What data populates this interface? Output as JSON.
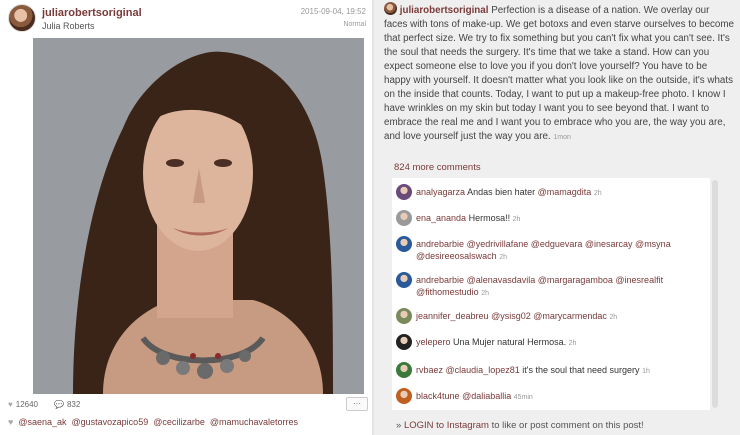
{
  "post": {
    "username": "juliarobertsoriginal",
    "real_name": "Julia Roberts",
    "timestamp": "2015-09-04, 19:52",
    "filter": "Normal",
    "likes": "12640",
    "comments_count": "832",
    "more_label": "···",
    "tags": [
      "@saena_ak",
      "@gustavozapico59",
      "@cecilizarbe",
      "@mamuchavaletorres"
    ]
  },
  "caption": {
    "username": "juliarobertsoriginal",
    "text": "Perfection is a disease of a nation. We overlay our faces with tons of make-up. We get botoxs and even starve ourselves to become that perfect size. We try to fix something but you can't fix what you can't see. It's the soul that needs the surgery. It's time that we take a stand. How can you expect someone else to love you if you don't love yourself? You have to be happy with yourself. It doesn't matter what you look like on the outside, it's whats on the inside that counts. Today, I want to put up a makeup-free photo. I know I have wrinkles on my skin but today I want you to see beyond that. I want to embrace the real me and I want you to embrace who you are, the way you are, and love yourself just the way you are.",
    "time": "1mon"
  },
  "more_comments": "824 more comments",
  "comments": [
    {
      "user": "analyagarza",
      "text": "Andas bien hater",
      "mentions": "@mamagdita",
      "time": "2h",
      "color": "#6a4a7a"
    },
    {
      "user": "ena_ananda",
      "text": "Hermosa!!",
      "mentions": "",
      "time": "2h",
      "color": "#9a9a9a"
    },
    {
      "user": "andrebarbie",
      "text": "",
      "mentions": "@yedrivillafane @edguevara @inesarcay @msyna @desireeosalswach",
      "time": "2h",
      "color": "#2a5a9a"
    },
    {
      "user": "andrebarbie",
      "text": "",
      "mentions": "@alenavasdavila @margaragamboa @inesrealfit @fithomestudio",
      "time": "2h",
      "color": "#2a5a9a"
    },
    {
      "user": "jeannifer_deabreu",
      "text": "",
      "mentions": "@ysisg02 @marycarmendac",
      "time": "2h",
      "color": "#7a8a5a"
    },
    {
      "user": "yelepero",
      "text": "Una Mujer natural Hermosa.",
      "mentions": "",
      "time": "2h",
      "color": "#222222"
    },
    {
      "user": "rvbaez",
      "text": "it's the soul that need surgery",
      "mentions": "@claudia_lopez81",
      "time": "1h",
      "color": "#3a7a3a"
    },
    {
      "user": "black4tune",
      "text": "",
      "mentions": "@daliaballia",
      "time": "45min",
      "color": "#c06020"
    }
  ],
  "login": {
    "prefix": "» ",
    "link": "LOGIN to Instagram",
    "suffix": " to like or post comment on this post!"
  },
  "colors": {
    "accent": "#7a3a3a",
    "panel_bg": "#efefef"
  }
}
